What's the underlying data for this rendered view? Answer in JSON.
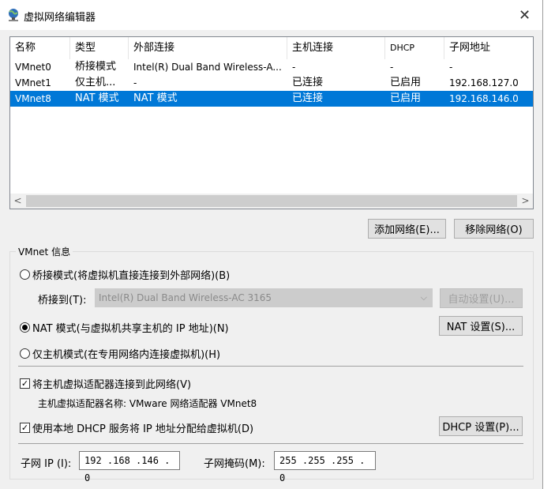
{
  "window": {
    "title": "虚拟网络编辑器",
    "title_icon": "globe-network-icon",
    "close_icon": "close-icon",
    "close_glyph": "✕"
  },
  "network_list": {
    "columns": [
      "名称",
      "类型",
      "外部连接",
      "主机连接",
      "DHCP",
      "子网地址"
    ],
    "rows": [
      {
        "name": "VMnet0",
        "type": "桥接模式",
        "external": "Intel(R) Dual Band Wireless-A...",
        "host": "-",
        "dhcp": "-",
        "subnet": "-"
      },
      {
        "name": "VMnet1",
        "type": "仅主机...",
        "external": "-",
        "host": "已连接",
        "dhcp": "已启用",
        "subnet": "192.168.127.0"
      },
      {
        "name": "VMnet8",
        "type": "NAT 模式",
        "external": "NAT 模式",
        "host": "已连接",
        "dhcp": "已启用",
        "subnet": "192.168.146.0"
      }
    ],
    "selected_row": 2,
    "scroll_left_glyph": "<",
    "scroll_right_glyph": ">"
  },
  "buttons": {
    "add_network": "添加网络(E)...",
    "remove_network": "移除网络(O)",
    "auto_settings": "自动设置(U)...",
    "nat_settings": "NAT 设置(S)...",
    "dhcp_settings": "DHCP 设置(P)..."
  },
  "vmnet_info": {
    "group_label": "VMnet 信息",
    "bridged_radio": "桥接模式(将虚拟机直接连接到外部网络)(B)",
    "bridged_to_label": "桥接到(T):",
    "bridged_to_value": "Intel(R) Dual Band Wireless-AC 3165",
    "bridged_to_arrow": "⌵",
    "nat_radio": "NAT 模式(与虚拟机共享主机的 IP 地址)(N)",
    "hostonly_radio": "仅主机模式(在专用网络内连接虚拟机)(H)",
    "selected_mode": "nat",
    "connect_adapter_check": "将主机虚拟适配器连接到此网络(V)",
    "adapter_name_label": "主机虚拟适配器名称: VMware 网络适配器 VMnet8",
    "use_dhcp_check": "使用本地 DHCP 服务将 IP 地址分配给虚拟机(D)",
    "check_glyph": "✓",
    "subnet_ip_label": "子网 IP (I):",
    "subnet_ip_value": "192 .168 .146 .  0",
    "subnet_mask_label": "子网掩码(M):",
    "subnet_mask_value": "255 .255 .255 .  0"
  },
  "colors": {
    "selection": "#0078d7",
    "window_bg": "#f0f0f0"
  }
}
